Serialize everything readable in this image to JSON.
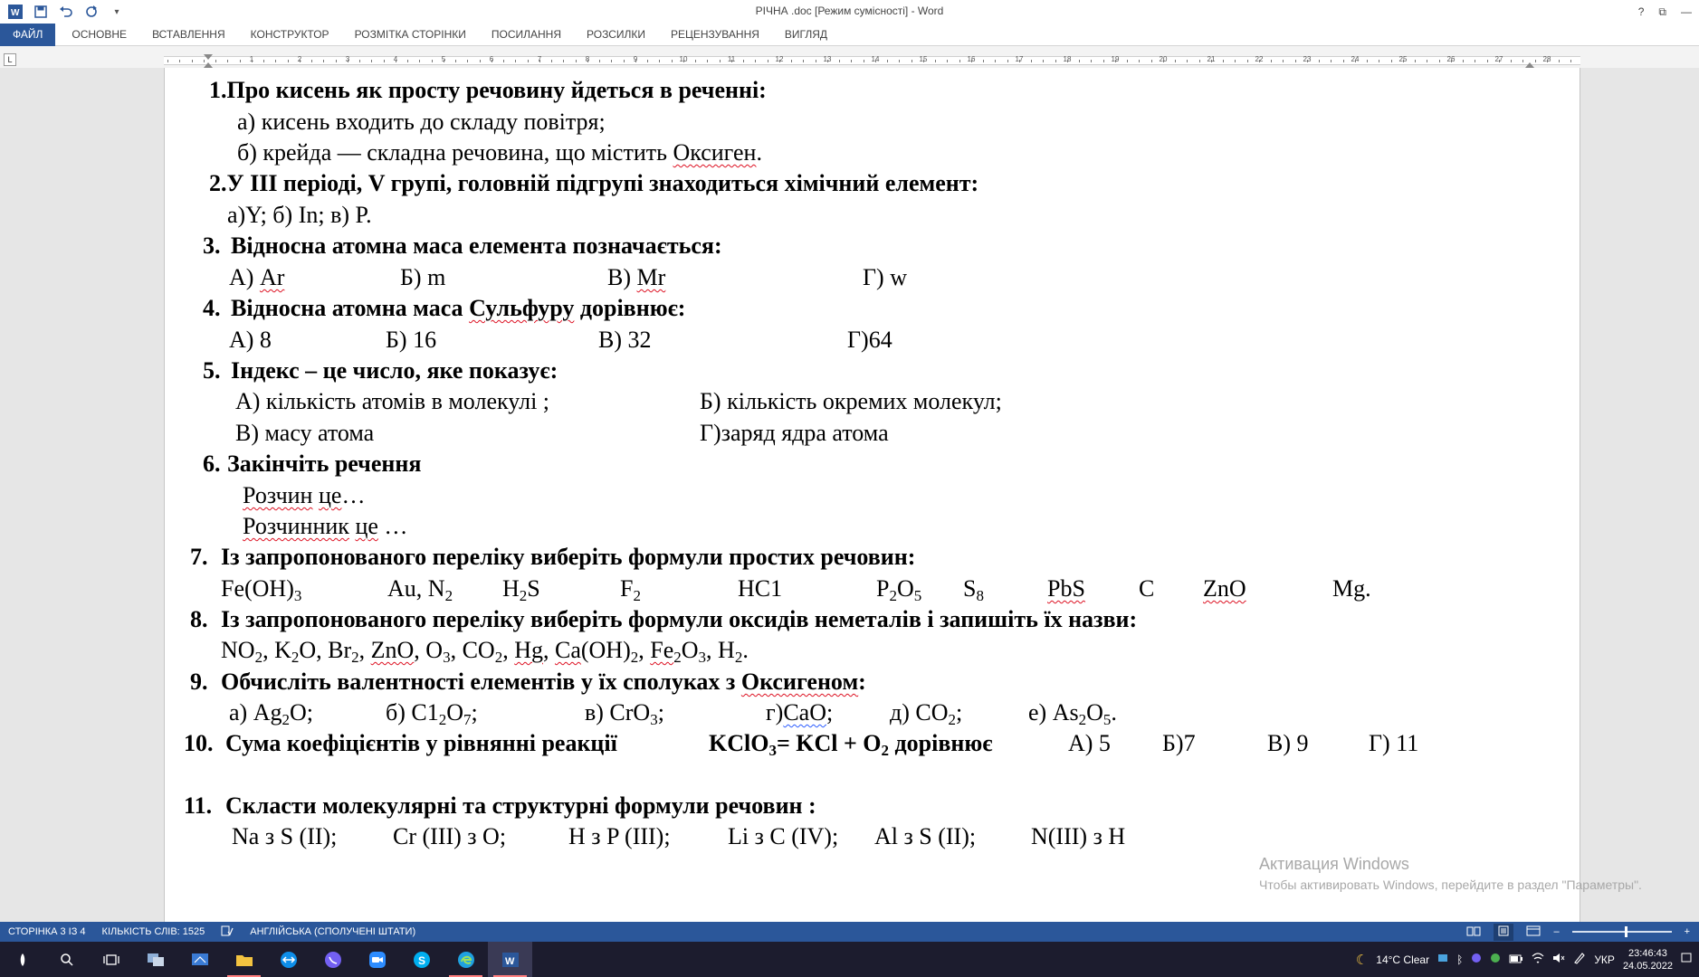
{
  "window": {
    "title": "РІЧНА .doc [Режим сумісності] - Word",
    "help": "?",
    "restore": "⧉",
    "minimize": "—"
  },
  "ribbon": {
    "tabs": [
      "ФАЙЛ",
      "ОСНОВНЕ",
      "ВСТАВЛЕННЯ",
      "КОНСТРУКТОР",
      "РОЗМІТКА СТОРІНКИ",
      "ПОСИЛАННЯ",
      "РОЗСИЛКИ",
      "РЕЦЕНЗУВАННЯ",
      "ВИГЛЯД"
    ]
  },
  "ruler": {
    "labels": [
      "1",
      "2",
      "3",
      "4",
      "5",
      "6",
      "7",
      "8",
      "9",
      "10",
      "11",
      "12",
      "13",
      "14",
      "15",
      "16",
      "17",
      "18",
      "19",
      "20",
      "21",
      "22",
      "23",
      "24",
      "25",
      "26",
      "27",
      "28"
    ],
    "corner": "L"
  },
  "document": {
    "q1_title": "1.Про кисень як просту речовину йдеться в реченні:",
    "q1_a": "а)  кисень входить до складу повітря;",
    "q1_b_pre": "б) крейда — складна речовина, що містить ",
    "q1_b_word": "Оксиген",
    "q1_b_post": ".",
    "q2_title": "2.У ІІІ періоді, V групі, головній підгрупі знаходиться хімічний елемент:",
    "q2_opts": "а)Y;   б) In;  в) P.",
    "q3_num": "3.",
    "q3_title": "Відносна атомна маса елемента позначається:",
    "q3_a_pre": "А)  ",
    "q3_a": "Ar",
    "q3_b": "Б)  m",
    "q3_c_pre": "В) ",
    "q3_c": "Mr",
    "q3_d": "Г) w",
    "q4_num": "4.",
    "q4_title_pre": "Відносна атомна маса ",
    "q4_title_word": "Сульфуру",
    "q4_title_post": " дорівнює:",
    "q4_a": "А)  8",
    "q4_b": "Б)  16",
    "q4_c": "В) 32",
    "q4_d": "Г)64",
    "q5_num": "5.",
    "q5_title": "Індекс – це число, яке показує:",
    "q5_a": "А) кількість атомів в молекулі ;",
    "q5_b": "Б) кількість окремих молекул;",
    "q5_c": "В)  масу атома",
    "q5_d": "Г)заряд ядра атома",
    "q6_num": "6.",
    "q6_title": "Закінчіть речення",
    "q6_l1_w1": "Розчин",
    "q6_l1_w2": "це",
    "q6_l1_end": "…",
    "q6_l2_w1": "Розчинник",
    "q6_l2_w2": "це",
    "q6_l2_end": " …",
    "q7_num": "7.",
    "q7_title": "Із запропонованого переліку виберіть формули простих речовин:",
    "q7_fe": "Fe(OH)",
    "q7_fe_sub": "3",
    "q7_au": "Au, N",
    "q7_au_sub": "2",
    "q7_h": "H",
    "q7_h_sub": "2",
    "q7_h_s": "S",
    "q7_f": "F",
    "q7_f_sub": "2",
    "q7_hc": "HC1",
    "q7_p": "P",
    "q7_p_sub1": "2",
    "q7_p_o": "O",
    "q7_p_sub2": "5",
    "q7_s": "S",
    "q7_s_sub": "8",
    "q7_pbs": "PbS",
    "q7_c": "C",
    "q7_zno": "ZnO",
    "q7_mg": "Mg.",
    "q8_num": "8.",
    "q8_title": "Із запропонованого переліку виберіть формули оксидів неметалів і запишіть їх назви:",
    "q8_no": "NO",
    "q8_k": "K",
    "q8_k_o": "O,",
    "q8_br": "Br",
    "q8_zno": "ZnO",
    "q8_o": "O",
    "q8_co": "CO",
    "q8_hg": "Hg",
    "q8_ca": "Ca",
    "q8_ca_rest": "(OH)",
    "q8_fe": "Fe",
    "q8_fe_o": "O",
    "q8_h": "H",
    "q8_sub2": "2",
    "q8_sub3": "3",
    "q8_comma": ",",
    "q8_end": ".",
    "q9_num": "9.",
    "q9_title_pre": "Обчисліть валентності елементів у їх сполуках з ",
    "q9_title_word": "Оксигеном",
    "q9_title_post": ":",
    "q9_a_pre": "а) Ag",
    "q9_a_post": "O;",
    "q9_b_pre": "б) C1",
    "q9_b_mid": "O",
    "q9_b_post": ";",
    "q9_c_pre": "в) CrO",
    "q9_c_post": ";",
    "q9_d_pre": "г)",
    "q9_d_word": "CaO",
    "q9_d_post": ";",
    "q9_e_pre": "д) CO",
    "q9_e_post": ";",
    "q9_f_pre": "е) As",
    "q9_f_mid": "O",
    "q9_f_post": ".",
    "q9_sub2": "2",
    "q9_sub3": "3",
    "q9_sub5": "5",
    "q9_sub7": "7",
    "q10_num": "10.",
    "q10_title": "Сума коефіцієнтів у рівнянні реакції",
    "q10_eq_pre": "KClO",
    "q10_eq_sub": "3",
    "q10_eq_mid": "= KCl + O",
    "q10_eq_sub2": "2",
    "q10_eq_post": "  дорівнює",
    "q10_a": "А) 5",
    "q10_b": "Б)7",
    "q10_c": "В) 9",
    "q10_d": "Г) 11",
    "q11_num": "11.",
    "q11_title": "Скласти молекулярні та структурні формули речовин :",
    "q11_1": "Na з S (II);",
    "q11_2": "Cr (III) з O;",
    "q11_3": "H з P (III);",
    "q11_4": "Li з C (IV);",
    "q11_5": "Al з  S (II);",
    "q11_6": "N(III) з H"
  },
  "activation": {
    "title": "Активация Windows",
    "subtitle": "Чтобы активировать Windows, перейдите в раздел \"Параметры\"."
  },
  "status": {
    "page": "СТОРІНКА 3 ІЗ 4",
    "words": "КІЛЬКІСТЬ СЛІВ: 1525",
    "language": "АНГЛІЙСЬКА (СПОЛУЧЕНІ ШТАТИ)",
    "zoom_minus": "–",
    "zoom_plus": "+",
    "zoom_fraction": 0.53
  },
  "taskbar": {
    "weather": "14°C  Clear",
    "lang": "УКР",
    "time": "23:46:43",
    "date": "24.05.2022"
  },
  "colors": {
    "word_blue": "#2b579a",
    "spell_red": "#d12222",
    "grammar_blue": "#2b5cff",
    "taskbar": "#1c1c2e"
  }
}
